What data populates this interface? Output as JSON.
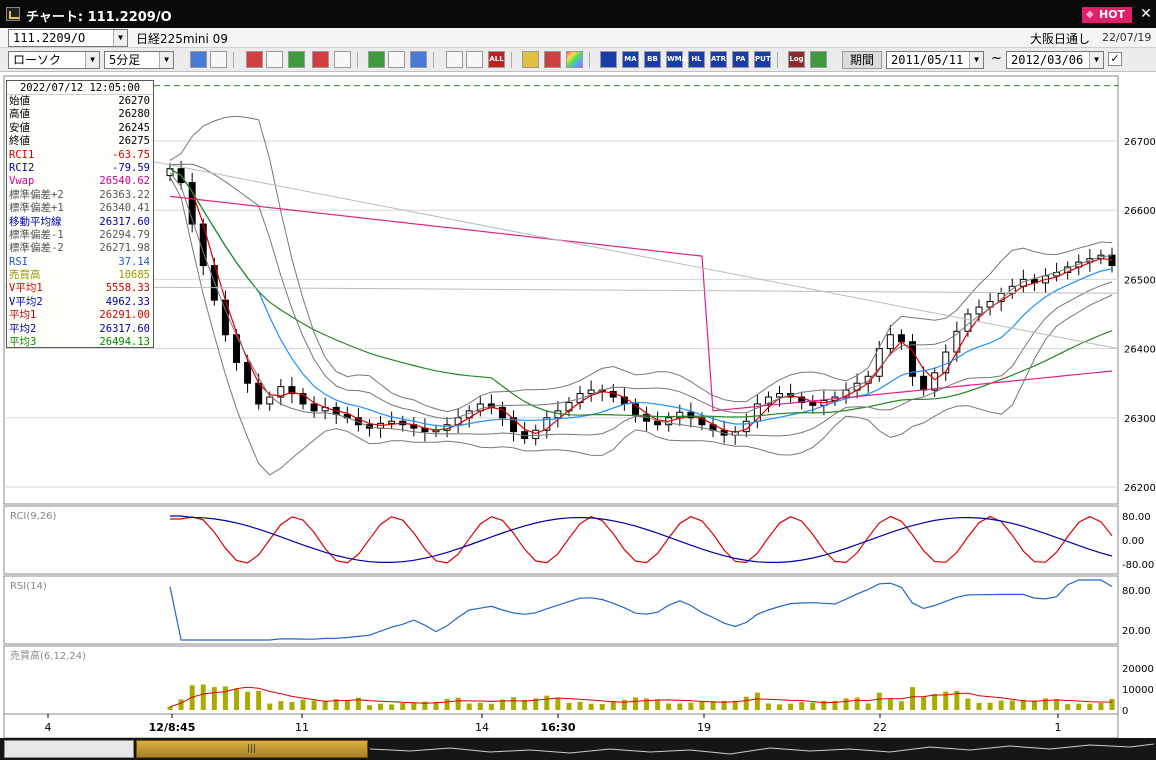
{
  "window": {
    "title": "チャート: 111.2209/O",
    "hot_label": "HOT",
    "close": "✕"
  },
  "info": {
    "symbol": "111.2209/O",
    "product": "日経225mini 09",
    "market": "大阪日通し",
    "date": "22/07/19"
  },
  "toolbar": {
    "chart_type": "ローソク",
    "timeframe": "5分足",
    "text_buttons": [
      "ALL",
      "MA",
      "BB",
      "WMA",
      "HL",
      "ATR",
      "PA",
      "PUT",
      "Log"
    ],
    "period_label": "期間",
    "range_start": "2011/05/11",
    "range_end": "2012/03/06",
    "range_separator": "~"
  },
  "data_window": {
    "datetime": "2022/07/12 12:05:00",
    "rows": [
      {
        "label": "始値",
        "value": "26270",
        "color": "#000000"
      },
      {
        "label": "高値",
        "value": "26280",
        "color": "#000000"
      },
      {
        "label": "安値",
        "value": "26245",
        "color": "#000000"
      },
      {
        "label": "終値",
        "value": "26275",
        "color": "#000000"
      },
      {
        "label": "RCI1",
        "value": "-63.75",
        "color": "#cc0000"
      },
      {
        "label": "RCI2",
        "value": "-79.59",
        "color": "#0000aa"
      },
      {
        "label": "Vwap",
        "value": "26540.62",
        "color": "#cc0099"
      },
      {
        "label": "標準偏差+2",
        "value": "26363.22",
        "color": "#555555"
      },
      {
        "label": "標準偏差+1",
        "value": "26340.41",
        "color": "#555555"
      },
      {
        "label": "移動平均線",
        "value": "26317.60",
        "color": "#0000aa"
      },
      {
        "label": "標準偏差-1",
        "value": "26294.79",
        "color": "#555555"
      },
      {
        "label": "標準偏差-2",
        "value": "26271.98",
        "color": "#555555"
      },
      {
        "label": "RSI",
        "value": "37.14",
        "color": "#2255cc"
      },
      {
        "label": "売買高",
        "value": "10685",
        "color": "#999900"
      },
      {
        "label": "V平均1",
        "value": "5558.33",
        "color": "#cc0000"
      },
      {
        "label": "V平均2",
        "value": "4962.33",
        "color": "#0000aa"
      },
      {
        "label": "平均1",
        "value": "26291.00",
        "color": "#cc0000"
      },
      {
        "label": "平均2",
        "value": "26317.60",
        "color": "#0000aa"
      },
      {
        "label": "平均3",
        "value": "26494.13",
        "color": "#008800"
      }
    ]
  },
  "colors": {
    "up_candle": "#ffffff",
    "down_candle": "#000000",
    "ma_short": "#dd0000",
    "ma_mid": "#1e90ff",
    "ma_long": "#228822",
    "vwap": "#dd2288",
    "bollinger": "#777777",
    "rci_fast": "#dd0000",
    "rci_slow": "#0000aa",
    "rsi": "#2266cc",
    "volume": "#aaaa00",
    "reference": "#228822"
  },
  "chart_data": {
    "type": "candlestick",
    "price_axis": {
      "ticks": [
        26200,
        26300,
        26400,
        26500,
        26600,
        26700
      ],
      "labels": [
        "26200",
        "26300",
        "26400",
        "26500",
        "26600",
        "26700"
      ]
    },
    "time_axis": {
      "labels": [
        "4",
        "12/8:45",
        "11",
        "14",
        "16:30",
        "19",
        "22",
        "1"
      ]
    },
    "reference_lines": [
      26780
    ],
    "close_series": [
      26660,
      26640,
      26580,
      26520,
      26470,
      26420,
      26380,
      26350,
      26320,
      26330,
      26345,
      26335,
      26320,
      26310,
      26315,
      26305,
      26300,
      26290,
      26285,
      26292,
      26295,
      26290,
      26285,
      26280,
      26282,
      26290,
      26300,
      26310,
      26320,
      26315,
      26300,
      26280,
      26270,
      26282,
      26300,
      26310,
      26322,
      26335,
      26340,
      26338,
      26330,
      26320,
      26305,
      26295,
      26290,
      26300,
      26308,
      26300,
      26290,
      26282,
      26275,
      26280,
      26295,
      26320,
      26330,
      26335,
      26330,
      26322,
      26318,
      26325,
      26330,
      26340,
      26350,
      26360,
      26400,
      26420,
      26410,
      26360,
      26340,
      26365,
      26395,
      26425,
      26450,
      26460,
      26468,
      26480,
      26490,
      26500,
      26495,
      26505,
      26510,
      26518,
      26525,
      26530,
      26535,
      26520
    ],
    "panels": {
      "rci": {
        "label": "RCI(9,26)",
        "ticks": [
          "80.00",
          "0.00",
          "-80.00"
        ]
      },
      "rsi": {
        "label": "RSI(14)",
        "ticks": [
          "80.00",
          "20.00"
        ]
      },
      "volume": {
        "label": "売買高(6,12,24)",
        "ticks": [
          "20000",
          "10000",
          "0"
        ]
      }
    }
  }
}
